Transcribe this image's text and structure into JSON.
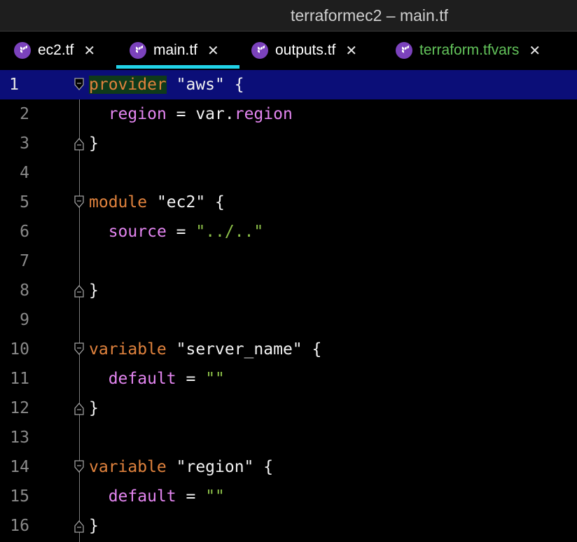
{
  "window": {
    "title": "terraformec2 – main.tf"
  },
  "tabs": [
    {
      "label": "ec2.tf",
      "icon": "terraform-icon",
      "active": false,
      "modified": false
    },
    {
      "label": "main.tf",
      "icon": "terraform-icon",
      "active": true,
      "modified": false
    },
    {
      "label": "outputs.tf",
      "icon": "terraform-icon",
      "active": false,
      "modified": false
    },
    {
      "label": "terraform.tfvars",
      "icon": "terraform-icon",
      "active": false,
      "modified": true
    }
  ],
  "tab_close_glyph": "✕",
  "colors": {
    "keyword": "#e0823d",
    "property": "#e385f0",
    "string": "#8dc149",
    "current_line": "#0b0e78",
    "active_tab_underline": "#21d3e8",
    "modified_tab": "#62c25a",
    "terraform_icon": "#7b42bc"
  },
  "editor": {
    "current_line": 1,
    "lines": [
      {
        "num": "1",
        "tokens": [
          {
            "t": "provider",
            "c": "kw hl"
          },
          {
            "t": " \"aws\" {",
            "c": "plain"
          }
        ]
      },
      {
        "num": "2",
        "tokens": [
          {
            "t": "  ",
            "c": "plain"
          },
          {
            "t": "region",
            "c": "prop"
          },
          {
            "t": " = var.",
            "c": "plain"
          },
          {
            "t": "region",
            "c": "prop"
          }
        ]
      },
      {
        "num": "3",
        "tokens": [
          {
            "t": "}",
            "c": "plain"
          }
        ]
      },
      {
        "num": "4",
        "tokens": []
      },
      {
        "num": "5",
        "tokens": [
          {
            "t": "module",
            "c": "kw"
          },
          {
            "t": " \"ec2\" {",
            "c": "plain"
          }
        ]
      },
      {
        "num": "6",
        "tokens": [
          {
            "t": "  ",
            "c": "plain"
          },
          {
            "t": "source",
            "c": "prop"
          },
          {
            "t": " = ",
            "c": "plain"
          },
          {
            "t": "\"../..\"",
            "c": "str"
          }
        ]
      },
      {
        "num": "7",
        "tokens": []
      },
      {
        "num": "8",
        "tokens": [
          {
            "t": "}",
            "c": "plain"
          }
        ]
      },
      {
        "num": "9",
        "tokens": []
      },
      {
        "num": "10",
        "tokens": [
          {
            "t": "variable",
            "c": "kw"
          },
          {
            "t": " \"server_name\" {",
            "c": "plain"
          }
        ]
      },
      {
        "num": "11",
        "tokens": [
          {
            "t": "  ",
            "c": "plain"
          },
          {
            "t": "default",
            "c": "prop"
          },
          {
            "t": " = ",
            "c": "plain"
          },
          {
            "t": "\"\"",
            "c": "str"
          }
        ]
      },
      {
        "num": "12",
        "tokens": [
          {
            "t": "}",
            "c": "plain"
          }
        ]
      },
      {
        "num": "13",
        "tokens": []
      },
      {
        "num": "14",
        "tokens": [
          {
            "t": "variable",
            "c": "kw"
          },
          {
            "t": " \"region\" {",
            "c": "plain"
          }
        ]
      },
      {
        "num": "15",
        "tokens": [
          {
            "t": "  ",
            "c": "plain"
          },
          {
            "t": "default",
            "c": "prop"
          },
          {
            "t": " = ",
            "c": "plain"
          },
          {
            "t": "\"\"",
            "c": "str"
          }
        ]
      },
      {
        "num": "16",
        "tokens": [
          {
            "t": "}",
            "c": "plain"
          }
        ]
      }
    ],
    "fold_open_lines": [
      1,
      5,
      10,
      14
    ],
    "fold_close_lines": [
      3,
      8,
      12,
      16
    ]
  }
}
